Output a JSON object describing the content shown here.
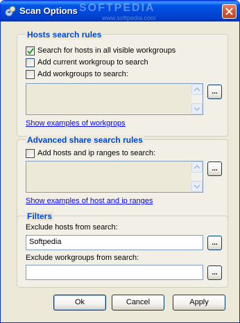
{
  "window": {
    "title": "Scan Options"
  },
  "watermark": {
    "main": "SOFTPEDIA",
    "sub": "www.softpedia.com"
  },
  "hosts_group": {
    "title": "Hosts search rules",
    "options": [
      {
        "label": "Search for hosts in all visible workgroups",
        "checked": true
      },
      {
        "label": "Add current workgroup to search",
        "checked": false
      },
      {
        "label": "Add workgroups to search:",
        "checked": false
      }
    ],
    "browse_label": "...",
    "examples_link": "Show examples of workgrops"
  },
  "share_group": {
    "title": "Advanced share search rules",
    "option": {
      "label": "Add hosts and ip ranges to search:",
      "checked": false
    },
    "browse_label": "...",
    "examples_link": "Show examples of host and ip ranges"
  },
  "filters_group": {
    "title": "Filters",
    "exclude_hosts_label": "Exclude hosts from search:",
    "exclude_hosts_value": "Softpedia",
    "exclude_workgroups_label": "Exclude workgroups from search:",
    "exclude_workgroups_value": "",
    "browse_label": "..."
  },
  "buttons": {
    "ok": "Ok",
    "cancel": "Cancel",
    "apply": "Apply"
  },
  "colors": {
    "titlebar": "#0055E5",
    "group_title": "#0046D5",
    "link": "#0000FF",
    "face": "#ECE9D8"
  }
}
